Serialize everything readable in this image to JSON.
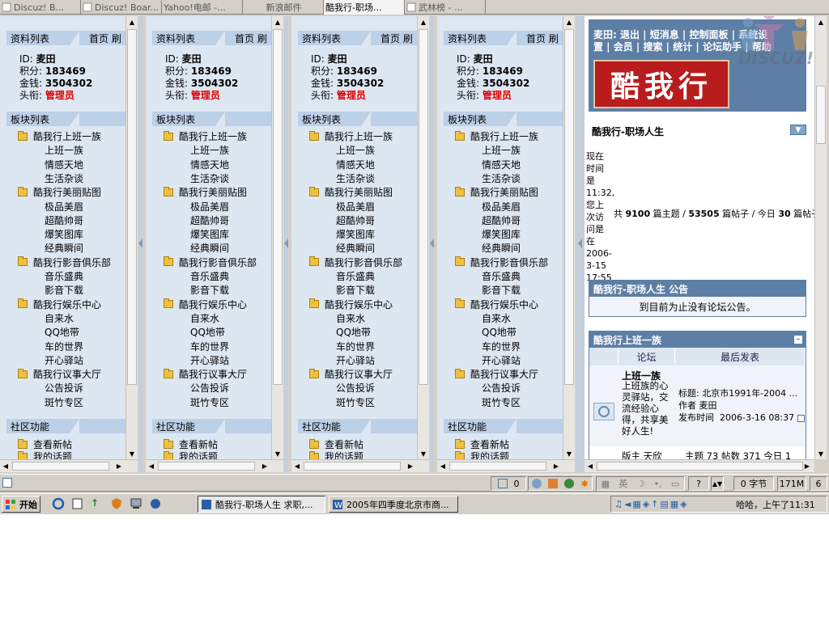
{
  "tabs": [
    {
      "label": "Discuz! B..."
    },
    {
      "label": "Discuz! Boar..."
    },
    {
      "label": "Yahoo!电邮 -..."
    },
    {
      "label": "新浪邮件"
    },
    {
      "label": "酷我行-职场..."
    },
    {
      "label": "武林榜 - ..."
    }
  ],
  "sidebar": {
    "profile_title": "资料列表",
    "home_link": "首页",
    "refresh_link": "刷",
    "id_label": "ID:",
    "id_value": "麦田",
    "points_label": "积分:",
    "points_value": "183469",
    "money_label": "金钱:",
    "money_value": "3504302",
    "rank_label": "头衔:",
    "rank_value": "管理员",
    "boards_title": "板块列表",
    "groups": [
      {
        "name": "酷我行上班一族",
        "subs": [
          "上班一族",
          "情感天地",
          "生活杂谈"
        ]
      },
      {
        "name": "酷我行美丽贴图",
        "subs": [
          "极品美眉",
          "超酷帅哥",
          "爆笑图库",
          "经典瞬间"
        ]
      },
      {
        "name": "酷我行影音俱乐部",
        "subs": [
          "音乐盛典",
          "影音下载"
        ]
      },
      {
        "name": "酷我行娱乐中心",
        "subs": [
          "自来水",
          "QQ地带",
          "车的世界",
          "开心驿站"
        ]
      },
      {
        "name": "酷我行议事大厅",
        "subs": [
          "公告投诉",
          "斑竹专区"
        ]
      }
    ],
    "community_title": "社区功能",
    "community_items": [
      "查看新帖",
      "我的话题"
    ]
  },
  "right": {
    "links_line1": "麦田: 退出 | 短消息 | 控制面板 | 系统设",
    "links_line2": "置 | 会员 | 搜索 | 统计 | 论坛助手 | 帮助",
    "logo_text": "酷我行",
    "brand_text": "DISCUZ!",
    "forum_title": "酷我行-职场人生",
    "time_text": [
      "现在",
      "时间",
      "是",
      "11:32,",
      "您上",
      "次访",
      "问是",
      "在",
      "2006-",
      "3-15",
      "17:55"
    ],
    "stats_prefix": "共",
    "stats_threads": "9100",
    "stats_mid1": "篇主题 /",
    "stats_posts": "53505",
    "stats_mid2": "篇帖子 / 今日",
    "stats_today": "30",
    "stats_suffix": "篇帖子",
    "announce_title": "酷我行-职场人生 公告",
    "announce_body": "到目前为止没有论坛公告。",
    "category_title": "酷我行上班一族",
    "col_forum": "论坛",
    "col_last": "最后发表",
    "forum_name": "上班一族",
    "forum_desc": [
      "上班族的心",
      "灵驿站，交",
      "流经验心",
      "得，共享美",
      "好人生!"
    ],
    "last_title": "标题: 北京市1991年-2004 ...",
    "last_author": "作者  麦田",
    "last_time_label": "发布时间",
    "last_time": "2006-3-16 08:37",
    "moderator": "版主 天欣",
    "counts": "主题 73 帖数 371 今日 1"
  },
  "statusbar": {
    "count1": "0",
    "ime_label": "英",
    "bytes": "0 字节",
    "memory": "171M",
    "page": "6"
  },
  "taskbar": {
    "start": "开始",
    "task1": "酷我行-职场人生 求职,...",
    "task2": "2005年四季度北京市商...",
    "clock": "哈哈，上午了11:31"
  }
}
